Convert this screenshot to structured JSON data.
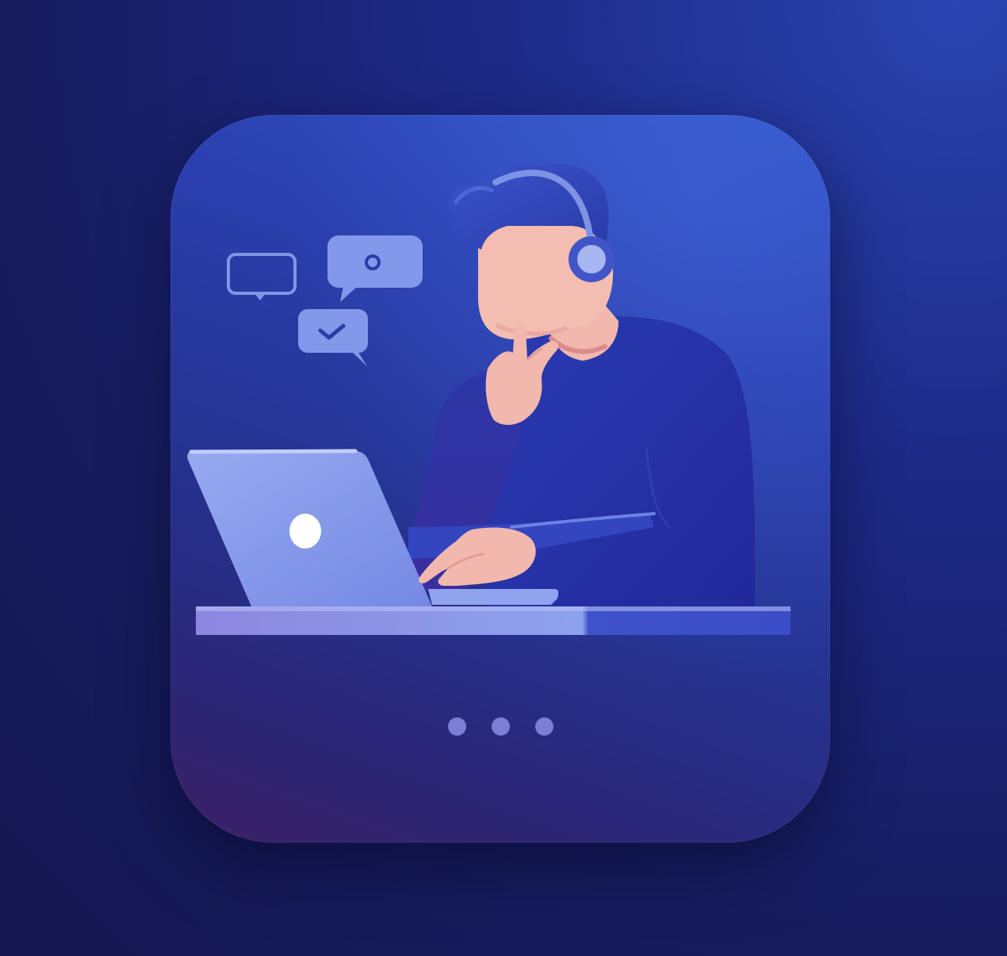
{
  "colors": {
    "background": "#171c5e",
    "card_top": "#3154c6",
    "card_bottom": "#3b2165",
    "skin": "#f1b7ad",
    "shirt": "#2a35a8",
    "hair": "#2e43b6",
    "laptop": "#8ba0ec",
    "desk": "#8f92e6",
    "bubble": "#7f93e6",
    "dot": "#7c7ed6"
  },
  "icons": {
    "empty_bubble": "speech-bubble-empty-icon",
    "circle_bubble": "speech-bubble-circle-icon",
    "check_bubble": "speech-bubble-check-icon",
    "laptop_logo": "laptop-logo-icon",
    "headset": "headset-icon"
  },
  "pagination": {
    "count": 3
  }
}
